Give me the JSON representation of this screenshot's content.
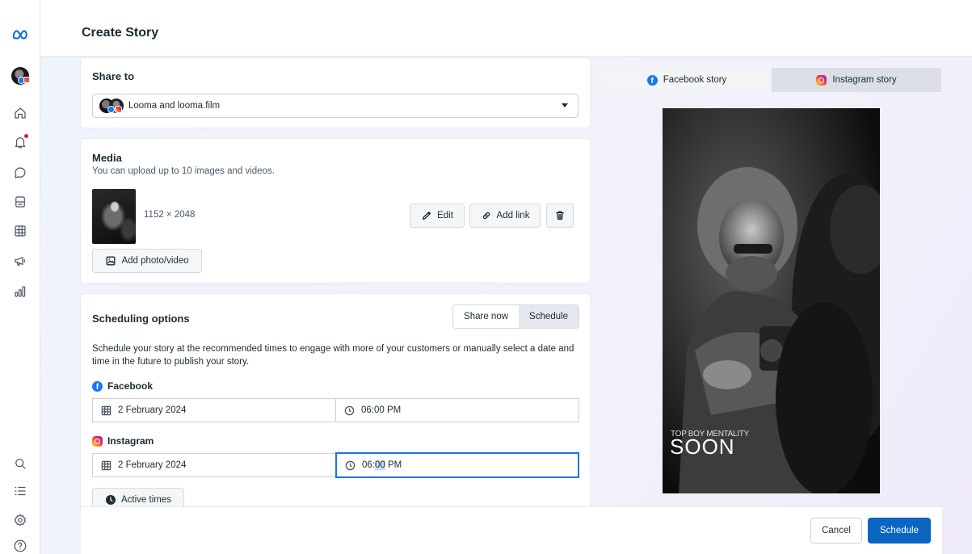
{
  "header": {
    "title": "Create Story"
  },
  "rail": {
    "icons": [
      "meta-logo-icon",
      "account-avatar",
      "home-icon",
      "notifications-icon",
      "messages-icon",
      "posts-icon",
      "calendar-grid-icon",
      "ads-megaphone-icon",
      "insights-icon",
      "search-icon",
      "menu-list-icon",
      "settings-icon",
      "help-icon"
    ]
  },
  "share_to": {
    "heading": "Share to",
    "selected_account": "Looma and looma.film"
  },
  "media": {
    "heading": "Media",
    "subtitle": "You can upload up to 10 images and videos.",
    "dimensions": "1152 × 2048",
    "edit_label": "Edit",
    "add_link_label": "Add link",
    "add_media_label": "Add photo/video"
  },
  "scheduling": {
    "heading": "Scheduling options",
    "share_now_label": "Share now",
    "schedule_label": "Schedule",
    "selected_mode": "Schedule",
    "description": "Schedule your story at the recommended times to engage with more of your customers or manually select a date and time in the future to publish your story.",
    "facebook": {
      "label": "Facebook",
      "date": "2 February 2024",
      "time_hour": "06",
      "time_min": "00",
      "time_ampm": "PM"
    },
    "instagram": {
      "label": "Instagram",
      "date": "2 February 2024",
      "time_hour": "06",
      "time_min": "00",
      "time_ampm": "PM"
    },
    "active_times_label": "Active times"
  },
  "preview": {
    "tabs": [
      {
        "label": "Facebook story"
      },
      {
        "label": "Instagram story"
      }
    ],
    "active_tab": "Instagram story",
    "overlay_small": "TOP BOY MENTALITY",
    "overlay_big": "SOON"
  },
  "footer": {
    "cancel_label": "Cancel",
    "schedule_label": "Schedule"
  },
  "colors": {
    "primary": "#0a66c2",
    "facebook": "#1877f2",
    "focus": "#1b74e4"
  }
}
